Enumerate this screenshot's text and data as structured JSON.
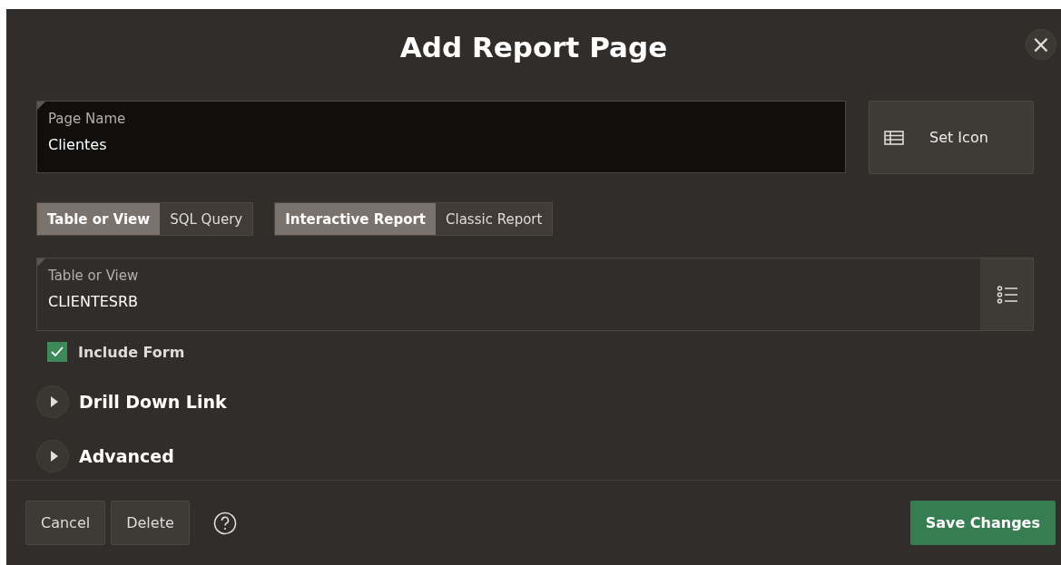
{
  "dialog": {
    "title": "Add Report Page",
    "close_icon": "×"
  },
  "page_name": {
    "label": "Page Name",
    "value": "Clientes"
  },
  "set_icon_button": {
    "label": "Set Icon"
  },
  "source_toggle": [
    {
      "label": "Table or View",
      "selected": true
    },
    {
      "label": "SQL Query",
      "selected": false
    }
  ],
  "report_toggle": [
    {
      "label": "Interactive Report",
      "selected": true
    },
    {
      "label": "Classic Report",
      "selected": false
    }
  ],
  "table_field": {
    "label": "Table or View",
    "value": "CLIENTESRB"
  },
  "include_form": {
    "label": "Include Form",
    "checked": true
  },
  "sections": [
    {
      "label": "Drill Down Link",
      "expanded": false
    },
    {
      "label": "Advanced",
      "expanded": false
    }
  ],
  "footer": {
    "buttons": [
      {
        "label": "Cancel",
        "kind": "plain"
      },
      {
        "label": "Delete",
        "kind": "plain"
      },
      {
        "label": "Save Changes",
        "kind": "primary"
      }
    ]
  }
}
